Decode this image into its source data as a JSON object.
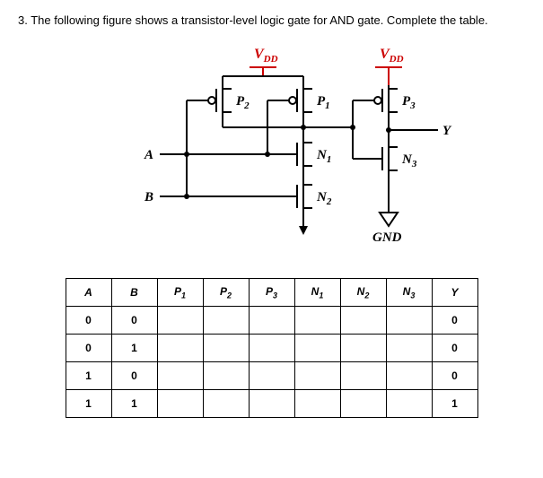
{
  "question": {
    "number": "3.",
    "text": "The following figure shows a transistor-level logic gate for AND gate.  Complete the table."
  },
  "circuit": {
    "vdd1": "V",
    "vdd1_sub": "DD",
    "vdd2": "V",
    "vdd2_sub": "DD",
    "A": "A",
    "B": "B",
    "P1": "P",
    "P1_sub": "1",
    "P2": "P",
    "P2_sub": "2",
    "P3": "P",
    "P3_sub": "3",
    "N1": "N",
    "N1_sub": "1",
    "N2": "N",
    "N2_sub": "2",
    "N3": "N",
    "N3_sub": "3",
    "Y": "Y",
    "GND": "GND"
  },
  "table": {
    "headers": {
      "A": "A",
      "B": "B",
      "P1": "P",
      "P1s": "1",
      "P2": "P",
      "P2s": "2",
      "P3": "P",
      "P3s": "3",
      "N1": "N",
      "N1s": "1",
      "N2": "N",
      "N2s": "2",
      "N3": "N",
      "N3s": "3",
      "Y": "Y"
    },
    "rows": [
      {
        "A": "0",
        "B": "0",
        "P1": "",
        "P2": "",
        "P3": "",
        "N1": "",
        "N2": "",
        "N3": "",
        "Y": "0"
      },
      {
        "A": "0",
        "B": "1",
        "P1": "",
        "P2": "",
        "P3": "",
        "N1": "",
        "N2": "",
        "N3": "",
        "Y": "0"
      },
      {
        "A": "1",
        "B": "0",
        "P1": "",
        "P2": "",
        "P3": "",
        "N1": "",
        "N2": "",
        "N3": "",
        "Y": "0"
      },
      {
        "A": "1",
        "B": "1",
        "P1": "",
        "P2": "",
        "P3": "",
        "N1": "",
        "N2": "",
        "N3": "",
        "Y": "1"
      }
    ]
  }
}
